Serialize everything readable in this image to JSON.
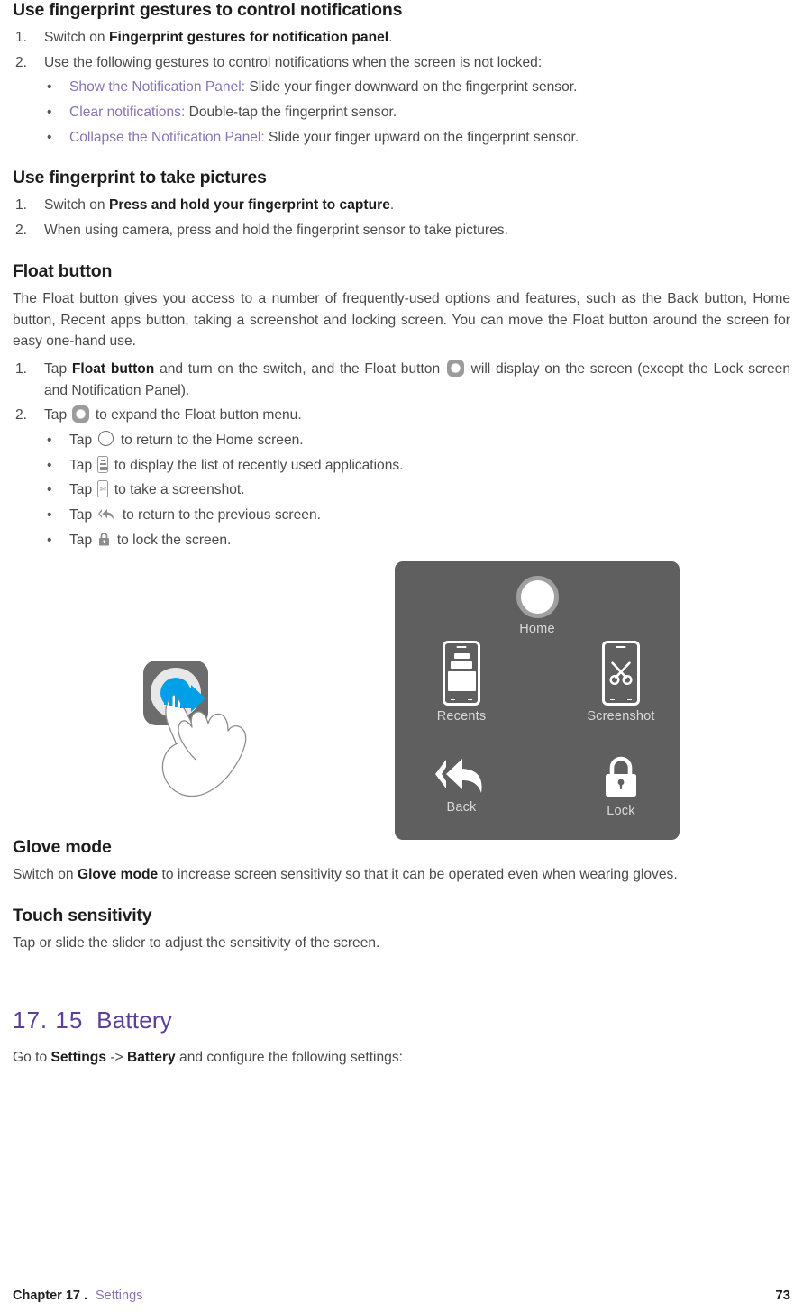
{
  "sections": [
    {
      "heading": "Use fingerprint gestures to control notifications",
      "steps": [
        {
          "marker": "1.",
          "pre": "Switch on ",
          "bold": "Fingerprint gestures for notification panel",
          "post": "."
        },
        {
          "marker": "2.",
          "pre": "Use the following gestures to control notifications when the screen is not locked:",
          "bold": "",
          "post": ""
        }
      ],
      "bullets": [
        {
          "link": "Show the Notification Panel:",
          "text": " Slide your finger downward on the fingerprint sensor."
        },
        {
          "link": "Clear notifications:",
          "text": " Double-tap the fingerprint sensor."
        },
        {
          "link": "Collapse the Notification Panel:",
          "text": " Slide your finger upward on the fingerprint sensor."
        }
      ]
    },
    {
      "heading": "Use fingerprint to take pictures",
      "steps": [
        {
          "marker": "1.",
          "pre": "Switch on ",
          "bold": "Press and hold your fingerprint to capture",
          "post": "."
        },
        {
          "marker": "2.",
          "pre": "When using camera, press and hold the fingerprint sensor to take pictures.",
          "bold": "",
          "post": ""
        }
      ]
    }
  ],
  "float_section": {
    "heading": "Float button",
    "intro": "The Float button gives you access to a number of frequently-used options and features, such as the Back button, Home button, Recent apps button, taking a screenshot and locking screen. You can move the Float button around the screen for easy one-hand use.",
    "step1": {
      "marker": "1.",
      "part_a": "Tap ",
      "bold": "Float button",
      "part_b": " and turn on the switch, and the Float button ",
      "part_c": " will display on the screen (except the Lock screen and Notification Panel)."
    },
    "step2": {
      "marker": "2.",
      "part_a": "Tap ",
      "part_b": " to expand the Float button menu."
    },
    "taps": [
      {
        "dot": "•",
        "pre": "Tap ",
        "icon": "home-circle-icon",
        "post": " to return to the Home screen."
      },
      {
        "dot": "•",
        "pre": "Tap ",
        "icon": "recents-phone-icon",
        "post": " to display the list of recently used applications."
      },
      {
        "dot": "•",
        "pre": "Tap ",
        "icon": "screenshot-scissors-icon",
        "post": " to take a screenshot."
      },
      {
        "dot": "•",
        "pre": "Tap ",
        "icon": "back-arrow-icon",
        "post": " to return to the previous screen."
      },
      {
        "dot": "•",
        "pre": "Tap ",
        "icon": "lock-icon",
        "post": " to lock the screen."
      }
    ]
  },
  "illustration": {
    "panel_bg": "#605f5f",
    "accent_blue": "#00a0e9",
    "items": [
      {
        "label": "Home",
        "icon": "home-circle-icon"
      },
      {
        "label": "Recents",
        "icon": "recents-phone-icon"
      },
      {
        "label": "Screenshot",
        "icon": "screenshot-scissors-icon"
      },
      {
        "label": "Back",
        "icon": "back-arrow-icon"
      },
      {
        "label": "Lock",
        "icon": "lock-icon"
      }
    ],
    "gesture": {
      "icon": "tap-hand-icon",
      "arrow": "right-arrow-icon"
    }
  },
  "glove": {
    "heading": "Glove mode",
    "pre": "Switch on ",
    "bold": "Glove mode",
    "post": " to increase screen sensitivity so that it can be operated even when wearing gloves."
  },
  "touch": {
    "heading": "Touch sensitivity",
    "text": "Tap or slide the slider to adjust the sensitivity of the screen."
  },
  "battery": {
    "number": "17. 15",
    "title": "Battery",
    "pre": "Go to ",
    "bold1": "Settings",
    "mid": " -> ",
    "bold2": "Battery",
    "post": " and configure the following settings:"
  },
  "footer": {
    "chapter": "Chapter 17 .",
    "section": "Settings",
    "page": "73"
  },
  "colors": {
    "link_purple": "#8a73b4",
    "heading_purple": "#5b3f99",
    "body_gray": "#4a4a4a",
    "panel_gray": "#605f5f",
    "accent_blue": "#00a0e9"
  }
}
